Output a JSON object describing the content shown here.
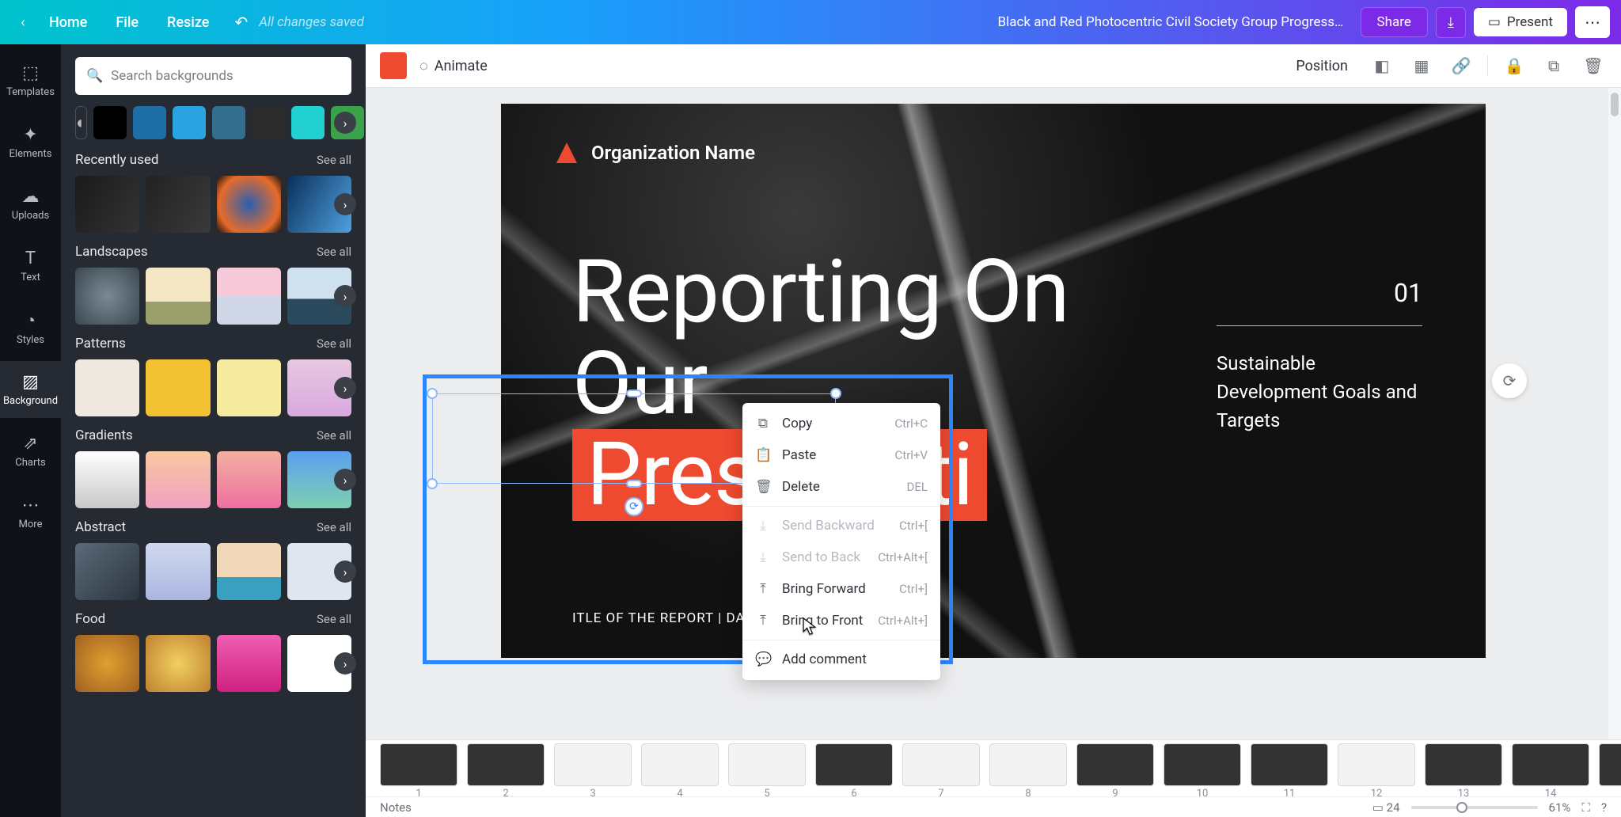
{
  "topbar": {
    "home": "Home",
    "file": "File",
    "resize": "Resize",
    "saved": "All changes saved",
    "doc_title": "Black and Red Photocentric Civil Society Group Progress Re...",
    "share": "Share",
    "present": "Present"
  },
  "rail": [
    {
      "label": "Templates",
      "icon": "⬚"
    },
    {
      "label": "Elements",
      "icon": "✦"
    },
    {
      "label": "Uploads",
      "icon": "☁"
    },
    {
      "label": "Text",
      "icon": "T"
    },
    {
      "label": "Styles",
      "icon": "◔"
    },
    {
      "label": "Background",
      "icon": "▨",
      "active": true
    },
    {
      "label": "Charts",
      "icon": "⇗"
    },
    {
      "label": "More",
      "icon": "⋯"
    }
  ],
  "panel": {
    "search_placeholder": "Search backgrounds",
    "swatches": [
      "#000000",
      "#1d6fa5",
      "#2aa3e0",
      "#336e8f",
      "#2b2b2b",
      "#22cfd1",
      "#3aa34a"
    ],
    "sections": [
      {
        "title": "Recently used",
        "see": "See all",
        "thumbs": [
          {
            "bg": "linear-gradient(120deg,#1a1a1a,#333)"
          },
          {
            "bg": "linear-gradient(120deg,#222,#3a3a3a)"
          },
          {
            "bg": "radial-gradient(circle,#2a5fb0,#e86b2a 70%,#111)"
          },
          {
            "bg": "linear-gradient(120deg,#0a2f5a,#4fa1e0)"
          }
        ]
      },
      {
        "title": "Landscapes",
        "see": "See all",
        "thumbs": [
          {
            "bg": "radial-gradient(circle,#7a8a94,#3a4750)"
          },
          {
            "bg": "linear-gradient(#f6e7c4 60%,#9aa06a 60%)"
          },
          {
            "bg": "linear-gradient(#f7c8d8 50%,#cfd7e6 50%)"
          },
          {
            "bg": "linear-gradient(#cfe1ef 55%,#2b4a5e 55%)"
          }
        ]
      },
      {
        "title": "Patterns",
        "see": "See all",
        "thumbs": [
          {
            "bg": "#efe8df"
          },
          {
            "bg": "#f2c233"
          },
          {
            "bg": "#f6e9a0"
          },
          {
            "bg": "linear-gradient(#e8c8e0,#d9a8e0)"
          }
        ]
      },
      {
        "title": "Gradients",
        "see": "See all",
        "thumbs": [
          {
            "bg": "linear-gradient(#ffffff,#c8c8c8)"
          },
          {
            "bg": "linear-gradient(#f7c8a0,#f2a0c0)"
          },
          {
            "bg": "linear-gradient(#f2b0a0,#ef6fa0)"
          },
          {
            "bg": "linear-gradient(#5aa0ef,#7ed0b0)"
          }
        ]
      },
      {
        "title": "Abstract",
        "see": "See all",
        "thumbs": [
          {
            "bg": "linear-gradient(135deg,#5a6a78,#2b3540)"
          },
          {
            "bg": "linear-gradient(#d0d8ef,#aab6e0)"
          },
          {
            "bg": "linear-gradient(#efd7b8 60%,#3aa0c0 60%)"
          },
          {
            "bg": "#dfe6ef"
          }
        ]
      },
      {
        "title": "Food",
        "see": "See all",
        "thumbs": [
          {
            "bg": "radial-gradient(circle,#e0a030,#a06020)"
          },
          {
            "bg": "radial-gradient(circle,#f0d060,#c08030)"
          },
          {
            "bg": "linear-gradient(#ef5fb0,#d02080)"
          },
          {
            "bg": "#fff"
          }
        ]
      }
    ]
  },
  "editor_bar": {
    "animate": "Animate",
    "position": "Position",
    "color": "#ed4a2f"
  },
  "slide": {
    "org": "Organization Name",
    "title_l1": "Reporting On",
    "title_l2": "Our",
    "title_hl": "Presentati",
    "sub": "ITLE OF THE REPORT  |  DATE OF THE REPORT",
    "num": "01",
    "side": "Sustainable Development Goals and Targets"
  },
  "context_menu": [
    {
      "icon": "⧉",
      "label": "Copy",
      "shortcut": "Ctrl+C",
      "enabled": true
    },
    {
      "icon": "📋",
      "label": "Paste",
      "shortcut": "Ctrl+V",
      "enabled": true
    },
    {
      "icon": "🗑",
      "label": "Delete",
      "shortcut": "DEL",
      "enabled": true
    },
    {
      "sep": true
    },
    {
      "icon": "⤓",
      "label": "Send Backward",
      "shortcut": "Ctrl+[",
      "enabled": false
    },
    {
      "icon": "⤓",
      "label": "Send to Back",
      "shortcut": "Ctrl+Alt+[",
      "enabled": false
    },
    {
      "icon": "⤒",
      "label": "Bring Forward",
      "shortcut": "Ctrl+]",
      "enabled": true
    },
    {
      "icon": "⤒",
      "label": "Bring to Front",
      "shortcut": "Ctrl+Alt+]",
      "enabled": true
    },
    {
      "sep": true
    },
    {
      "icon": "💬",
      "label": "Add comment",
      "shortcut": "",
      "enabled": true
    }
  ],
  "thumbnails": {
    "count": 15,
    "light": [
      3,
      4,
      5,
      7,
      8,
      12
    ]
  },
  "footer": {
    "notes": "Notes",
    "pages": "24",
    "zoom": "61%"
  }
}
